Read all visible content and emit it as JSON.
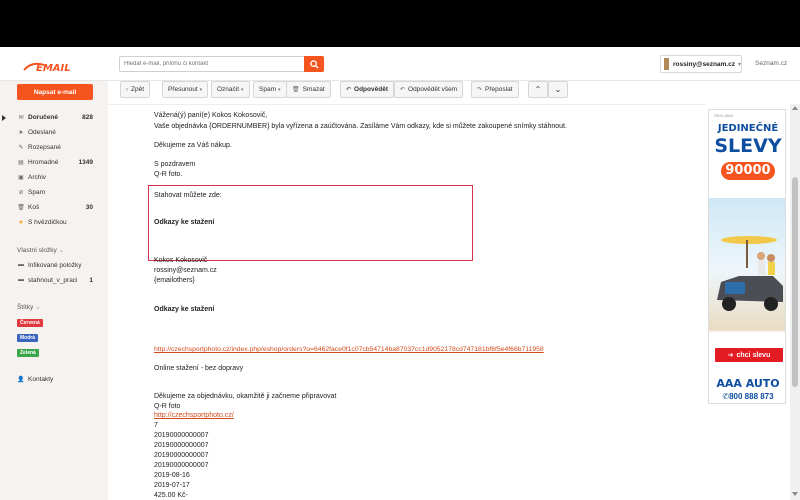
{
  "header": {
    "logo_text": "EMAIL",
    "search_placeholder": "Hledat e-mail, přílohu či kontakt",
    "user_email": "rossiny@seznam.cz",
    "seznam_link": "Seznam.cz"
  },
  "sidebar": {
    "compose_label": "Napsat e-mail",
    "folders": [
      {
        "label": "Doručené",
        "count": "828",
        "icon": "inbox-icon"
      },
      {
        "label": "Odeslané",
        "count": "",
        "icon": "sent-icon"
      },
      {
        "label": "Rozepsané",
        "count": "",
        "icon": "draft-icon"
      },
      {
        "label": "Hromadné",
        "count": "1349",
        "icon": "bulk-icon"
      },
      {
        "label": "Archiv",
        "count": "",
        "icon": "archive-icon"
      },
      {
        "label": "Spam",
        "count": "",
        "icon": "spam-icon"
      },
      {
        "label": "Koš",
        "count": "30",
        "icon": "trash-icon"
      },
      {
        "label": "S hvězdičkou",
        "count": "",
        "icon": "star-icon"
      }
    ],
    "custom_section": "Vlastní složky",
    "custom_folders": [
      {
        "label": "Infikované položky",
        "count": ""
      },
      {
        "label": "stahnout_v_praci",
        "count": "1"
      }
    ],
    "tags_section": "Štítky",
    "tags": [
      {
        "label": "Červená",
        "color": "#e0393e"
      },
      {
        "label": "Modrá",
        "color": "#3a64c0"
      },
      {
        "label": "Zelená",
        "color": "#3aa64a"
      }
    ],
    "contacts_label": "Kontakty"
  },
  "toolbar": {
    "back": "Zpět",
    "move": "Přesunout",
    "mark": "Označit",
    "spam": "Spam",
    "delete": "Smazat",
    "reply": "Odpovědět",
    "reply_all": "Odpovědět všem",
    "forward": "Přeposlat"
  },
  "message": {
    "greeting": "Vážená(ý) paní(e) Kokos Kokosovič,",
    "line1": "Vaše objednávka {ORDERNUMBER} byla vyřízena a zaúčtována. Zasíláme Vám odkazy, kde si můžete zakoupené snímky stáhnout.",
    "thanks": "Děkujeme za Váš nákup.",
    "regards": "S pozdravem",
    "sender_name": "Q-R foto.",
    "download_here": "Stahovat můžete zde:",
    "download_links_1": "Odkazy ke stažení",
    "sig_name": "Kokos Kokosovič",
    "sig_email": "rossiny@seznam.cz",
    "sig_others": "{emailothers}",
    "download_links_2": "Odkazy ke stažení",
    "long_url": "http://czechsportphoto.cz/index.php/eshop/orders?o=6462face0f1c07cb54714ba87037cc1d9052178cd747181bf6f5e4f66b711958",
    "online_download": "Online stažení - bez dopravy",
    "order_thanks": "Děkujeme za objednávku, okamžitě ji začneme připravovat",
    "company": "Q-R foto",
    "company_url": "http://czechsportphoto.cz/",
    "lines": [
      "7",
      "20190000000007",
      "20190000000007",
      "20190000000007",
      "20190000000007",
      "2019-08-16",
      "2019-07-17",
      "425.00 Kč-"
    ]
  },
  "ad": {
    "small_label": "REKLAMA",
    "headline_1": "JEDINEČNÉ",
    "headline_2": "SLEVY",
    "price": "90000",
    "cta": "chci slevu",
    "brand": "AAA AUTO",
    "phone": "800 888 873"
  }
}
